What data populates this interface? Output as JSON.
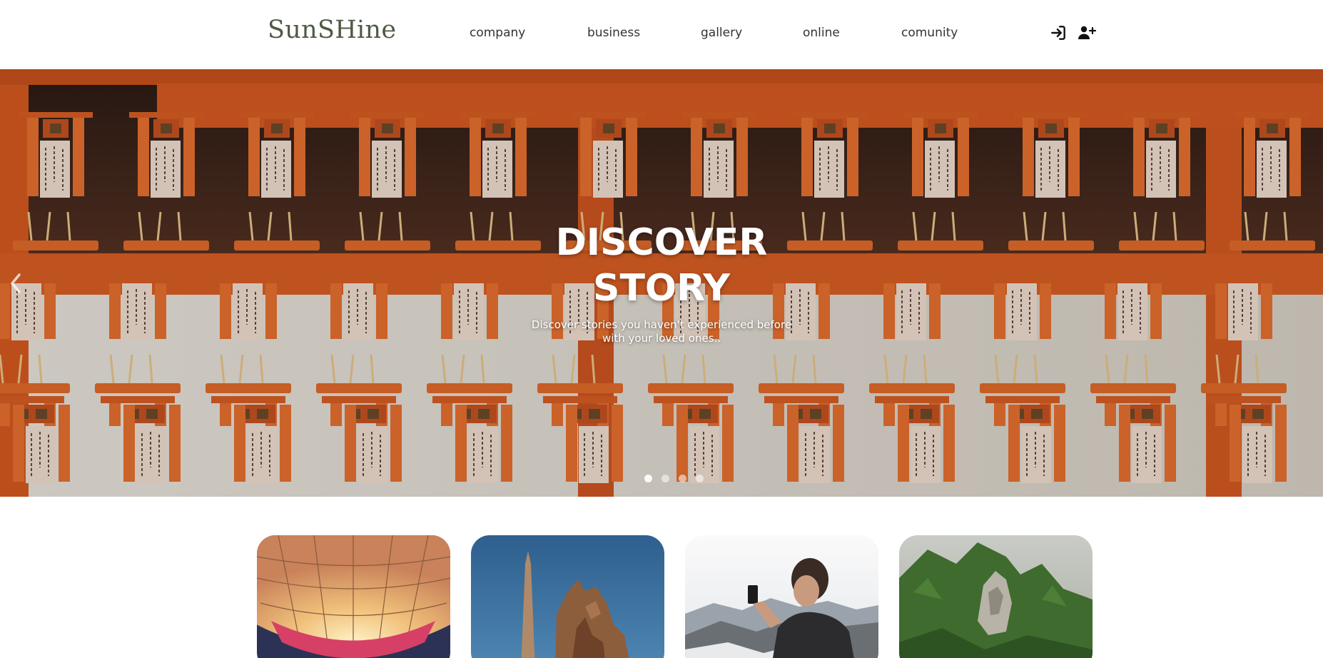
{
  "header": {
    "logo": "SunSHine",
    "nav": [
      "company",
      "business",
      "gallery",
      "online",
      "comunity"
    ],
    "icons": [
      "login-icon",
      "add-user-icon"
    ]
  },
  "hero": {
    "title_line1": "DISCOVER",
    "title_line2": "STORY",
    "subtitle": "Discover stories you haven't experienced before with your loved ones..",
    "slide_count": 4,
    "active_slide": 1
  },
  "cards": [
    {
      "image": "hot-air-balloon"
    },
    {
      "image": "obelisk-ruins"
    },
    {
      "image": "person-photographing-mountains"
    },
    {
      "image": "rock-sculpture-cliff"
    }
  ],
  "colors": {
    "logo": "#4f5a45",
    "nav_text": "#333333",
    "hero_accent": "#d2602a"
  }
}
